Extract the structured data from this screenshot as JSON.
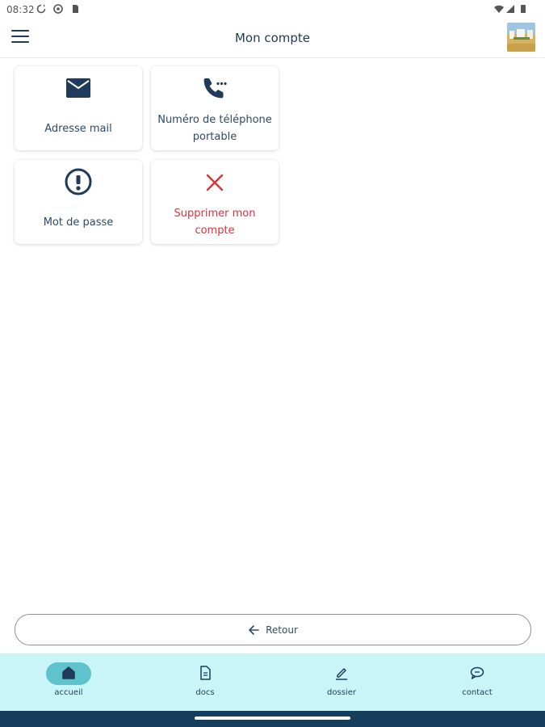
{
  "status_bar": {
    "time": "08:32"
  },
  "app_bar": {
    "title": "Mon compte"
  },
  "cards": [
    {
      "label": "Adresse mail",
      "icon": "mail-icon"
    },
    {
      "label": "Numéro de téléphone portable",
      "icon": "phone-icon"
    },
    {
      "label": "Mot de passe",
      "icon": "info-icon"
    },
    {
      "label": "Supprimer mon compte",
      "icon": "close-icon"
    }
  ],
  "back_button": {
    "label": "Retour"
  },
  "bottom_nav": [
    {
      "label": "accueil",
      "icon": "home-icon",
      "active": true
    },
    {
      "label": "docs",
      "icon": "document-icon",
      "active": false
    },
    {
      "label": "dossier",
      "icon": "pencil-icon",
      "active": false
    },
    {
      "label": "contact",
      "icon": "chat-icon",
      "active": false
    }
  ],
  "colors": {
    "primary": "#1f3a5a",
    "danger": "#e0303a",
    "nav_bg": "#c9f5f9",
    "nav_active": "#5fc3cc",
    "system_bar": "#153d5c"
  }
}
